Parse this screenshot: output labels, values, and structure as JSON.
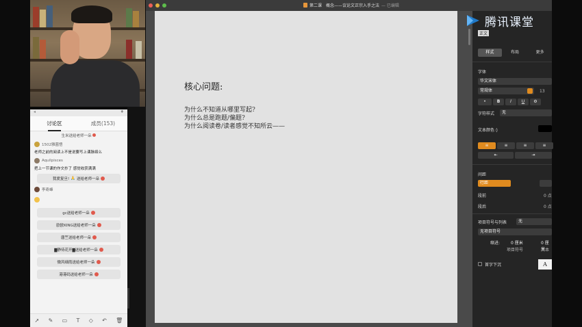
{
  "window": {
    "title": "第二课　概念——议论文正宗入手之法",
    "edited": "— 已编辑",
    "traffic_colors": [
      "#ec5f57",
      "#e1b13d",
      "#5dbd4c"
    ]
  },
  "brand": {
    "name": "腾讯课堂"
  },
  "chat": {
    "top_left": "◂",
    "top_right": "♦",
    "tabs": [
      {
        "label": "讨论区",
        "active": true
      },
      {
        "label": "成员(153)",
        "active": false
      }
    ],
    "cut_gift": "生米送给老师一朵",
    "messages": [
      {
        "user": "1502雅菌悟",
        "text": "老师之前的阅读上不是说要写上课脉络么"
      },
      {
        "user": "Aquilpisces",
        "text": "把上一节课的作文抄了 感觉收获满满"
      }
    ],
    "gift_mid": {
      "user": "我爱复旦!",
      "text": "送给老师一朵"
    },
    "emoji_user": "李奇峰",
    "gifts": [
      "gc送给老师一朵",
      "欧欧KING送给老师一朵",
      "唐竺送给老师一朵",
      "▇静待花开▇送给老师一朵",
      "微风细雨送给老师一朵",
      "港港码送给老师一朵"
    ],
    "tools": [
      "arrow-icon",
      "pen-icon",
      "rect-icon",
      "text-icon",
      "eraser-icon",
      "undo-icon",
      "trash-icon"
    ]
  },
  "document": {
    "heading": "核心问题:",
    "lines": [
      "为什么不知道从哪里写起?",
      "为什么总是跑题/偏题?",
      "为什么阅读卷/读者感觉不知所云——"
    ]
  },
  "inspector": {
    "tag": "正文",
    "tabs": [
      {
        "label": "样式",
        "active": true
      },
      {
        "label": "布局",
        "active": false
      },
      {
        "label": "更多",
        "active": false
      }
    ],
    "font_section": "字体",
    "font_family": "华文宋体",
    "font_style": "常规体",
    "font_size": "13",
    "format_buttons": [
      "•",
      "B",
      "I",
      "U",
      "⚙"
    ],
    "char_style_label": "字符样式",
    "char_style_value": "无",
    "text_color_label": "文本颜色 ◊",
    "align_buttons": [
      "≡",
      "≡",
      "≡",
      "≡"
    ],
    "indent_buttons": [
      "⇤",
      "⇥"
    ],
    "spacing_section": "间距",
    "spacing_value": "行距",
    "before_label": "段前",
    "after_label": "段后",
    "before_value": "0 点",
    "after_value": "0 点",
    "bullets_label": "项目符号与列表",
    "bullets_value": "无",
    "bullets_type": "无项目符号",
    "indent_label": "缩进:",
    "indent_bullet_val": "0 厘米",
    "indent_text_val": "0 厘米",
    "indent_bullet_cap": "项目符号",
    "indent_text_cap": "文本",
    "dropcap_label": "首字下沉",
    "preview_glyph": "A"
  }
}
